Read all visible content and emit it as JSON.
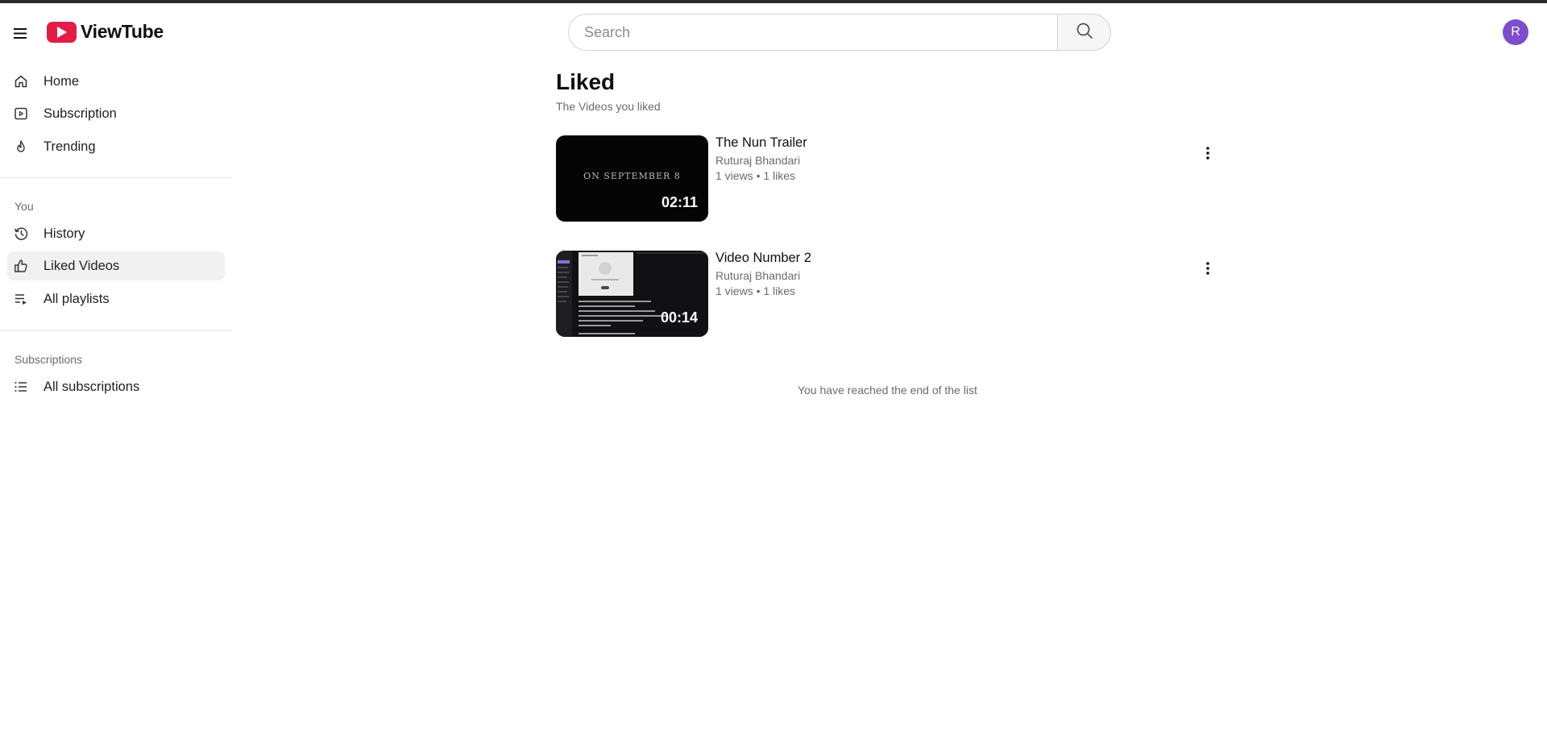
{
  "header": {
    "menu_icon": "hamburger-menu-icon",
    "logo_icon": "play-icon",
    "app_name": "ViewTube",
    "search_placeholder": "Search",
    "search_value": "",
    "search_icon": "search-icon",
    "avatar_letter": "R",
    "avatar_color": "#7c4dcc",
    "brand_color": "#e11d48"
  },
  "sidebar": {
    "main_items": [
      {
        "label": "Home",
        "icon": "home-icon"
      },
      {
        "label": "Subscription",
        "icon": "subscription-icon"
      },
      {
        "label": "Trending",
        "icon": "flame-icon"
      }
    ],
    "you_section_label": "You",
    "you_items": [
      {
        "label": "History",
        "icon": "history-icon"
      },
      {
        "label": "Liked Videos",
        "icon": "thumbs-up-icon",
        "active": true
      },
      {
        "label": "All playlists",
        "icon": "playlist-icon"
      }
    ],
    "subscriptions_section_label": "Subscriptions",
    "subscription_items": [
      {
        "label": "All subscriptions",
        "icon": "list-icon"
      }
    ]
  },
  "main": {
    "title": "Liked",
    "subtitle": "The Videos you liked",
    "videos": [
      {
        "title": "The Nun Trailer",
        "channel": "Ruturaj Bhandari",
        "views": "1 views",
        "likes": "1 likes",
        "separator": "•",
        "duration": "02:11",
        "thumbnail_text": "ON SEPTEMBER 8"
      },
      {
        "title": "Video Number 2",
        "channel": "Ruturaj Bhandari",
        "views": "1 views",
        "likes": "1 likes",
        "separator": "•",
        "duration": "00:14",
        "thumbnail_text": ""
      }
    ],
    "end_message": "You have reached the end of the list"
  }
}
